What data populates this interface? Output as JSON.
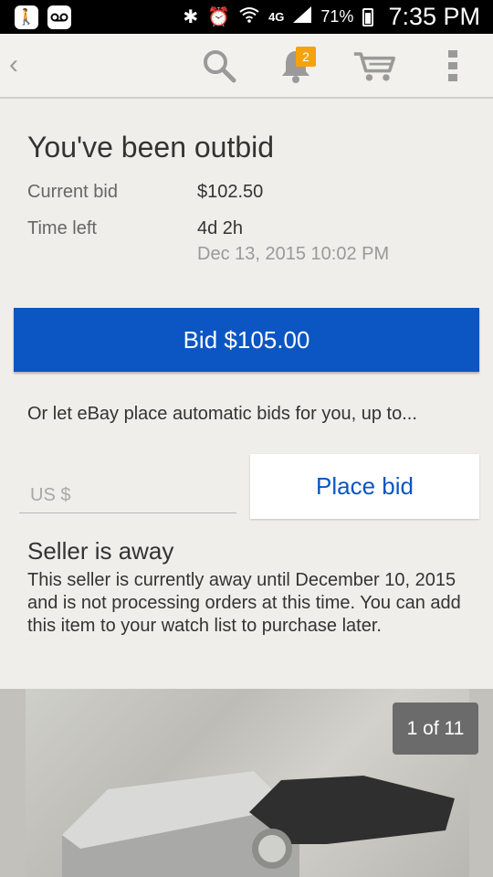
{
  "status_bar": {
    "network": "4G",
    "battery_percent": "71%",
    "time": "7:35 PM"
  },
  "toolbar": {
    "notification_count": "2"
  },
  "outbid": {
    "title": "You've been outbid",
    "current_bid_label": "Current bid",
    "current_bid_value": "$102.50",
    "time_left_label": "Time left",
    "time_left_value": "4d 2h",
    "end_date": "Dec 13, 2015 10:02 PM"
  },
  "bid_button_label": "Bid $105.00",
  "auto_bid": {
    "text": "Or let eBay place automatic bids for you, up to...",
    "currency_placeholder": "US $",
    "place_bid_label": "Place bid"
  },
  "seller": {
    "title": "Seller is away",
    "body": "This seller is currently away until December 10, 2015 and is not processing orders at this time. You can add this item to your watch list to purchase later."
  },
  "gallery": {
    "counter": "1 of 11"
  },
  "colors": {
    "primary": "#0b56c2",
    "badge": "#f5a20c"
  }
}
